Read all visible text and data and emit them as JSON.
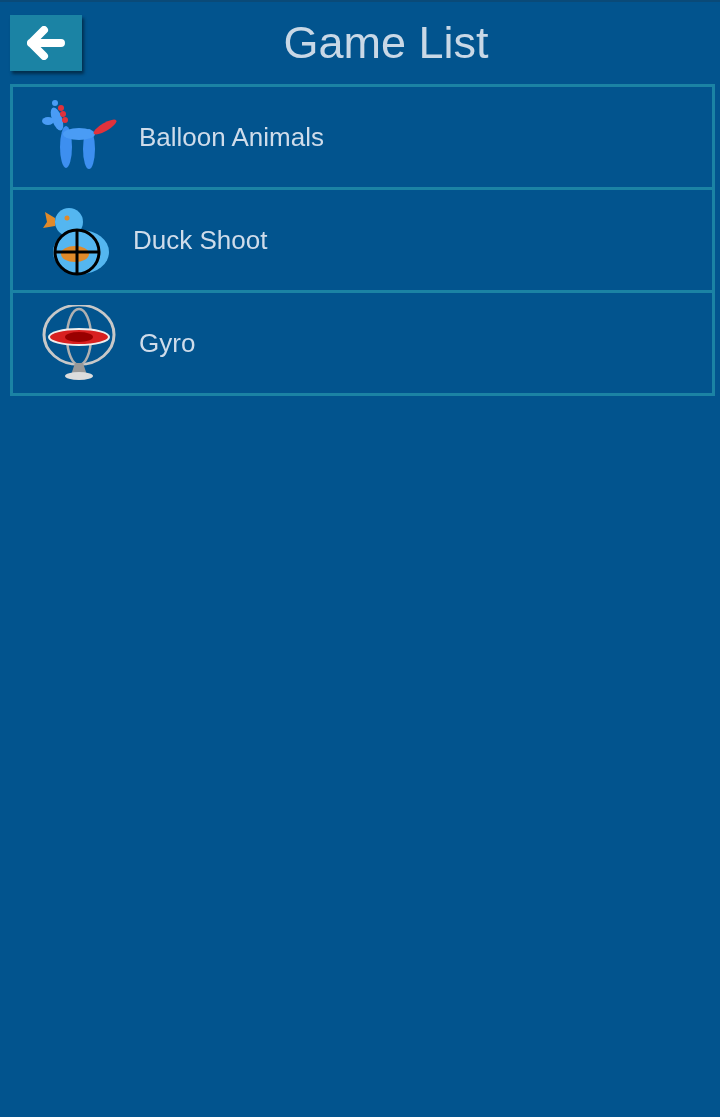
{
  "header": {
    "title": "Game List"
  },
  "games": [
    {
      "kind": "balloon",
      "name": "Balloon Animals"
    },
    {
      "kind": "duck",
      "name": "Duck Shoot"
    },
    {
      "kind": "gyro",
      "name": "Gyro"
    }
  ]
}
